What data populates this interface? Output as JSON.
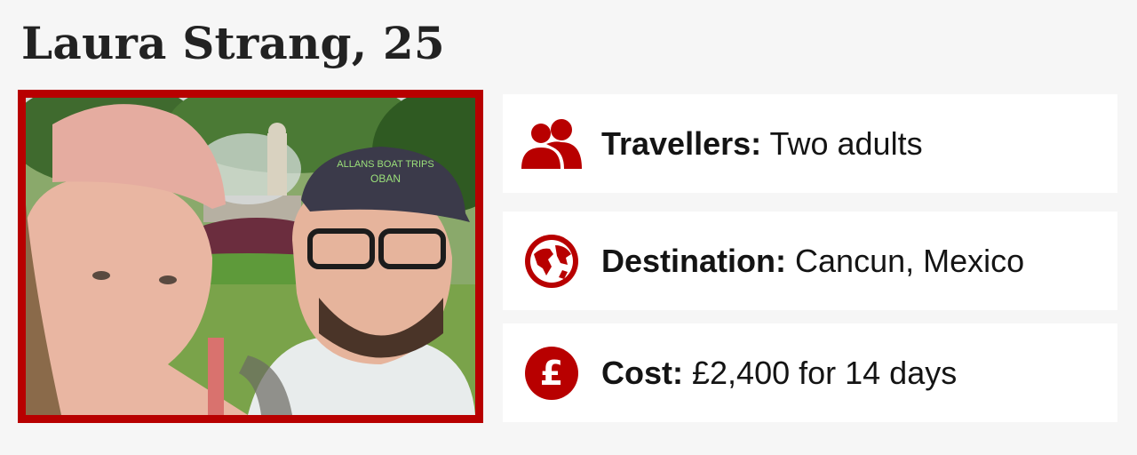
{
  "heading": "Laura Strang, 25",
  "photo": {
    "cap_text_line1": "ALLANS BOAT TRIPS",
    "cap_text_line2": "OBAN"
  },
  "cards": [
    {
      "icon": "people-icon",
      "label": "Travellers:",
      "value": "Two adults"
    },
    {
      "icon": "globe-icon",
      "label": "Destination:",
      "value": "Cancun, Mexico"
    },
    {
      "icon": "pound-icon",
      "label": "Cost:",
      "value": "£2,400 for 14 days"
    }
  ],
  "colors": {
    "accent": "#b80000",
    "background": "#f6f6f6",
    "card": "#ffffff"
  }
}
